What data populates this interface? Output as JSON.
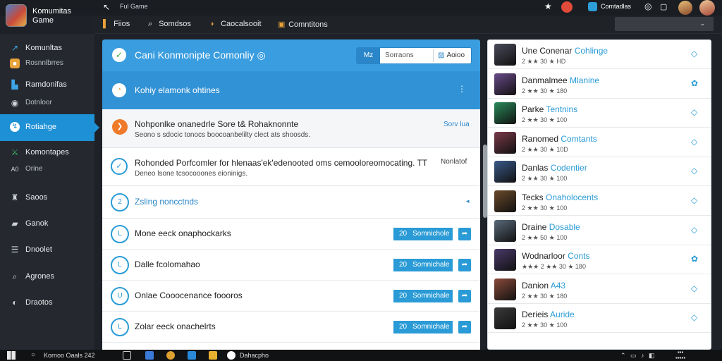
{
  "app": {
    "title": "Komumitas Game"
  },
  "topbar": {
    "title": "Ful Game",
    "contacts": "Comtadlas"
  },
  "tabs": [
    {
      "label": "Fiios"
    },
    {
      "label": "Somdsos"
    },
    {
      "label": "Caocalsooit"
    },
    {
      "label": "Comntitons"
    }
  ],
  "sidebar": {
    "items": [
      {
        "label": "Komunltas"
      },
      {
        "label": "Rosnnlbrres"
      },
      {
        "label": "Ramdonifas"
      },
      {
        "label": "Dotnloor"
      },
      {
        "label": "Rotiahge"
      },
      {
        "label": "Komontapes"
      },
      {
        "label": "Orine"
      },
      {
        "label": "Saoos"
      },
      {
        "label": "Ganok"
      },
      {
        "label": "Dnoolet"
      },
      {
        "label": "Agrones"
      },
      {
        "label": "Draotos"
      }
    ],
    "online_prefix": "A0"
  },
  "main": {
    "header": {
      "title": "Cani Konmonipte Comonliy",
      "seg_left": "Mz",
      "seg_search": "Sorraons",
      "seg_right": "Aoioo"
    },
    "subheader": {
      "title": "Kohiy elamonk ohtines",
      "more": "⋮"
    },
    "notification": {
      "line1": "Nohponlke onanedrle Sore t& Rohaknonnte",
      "line2": "Seono s sdocic tonocs boocoanbelilty clect ats shoosds.",
      "link": "Sorv lua"
    },
    "recommended": {
      "line1": "Rohonded Porfcomler for hlenaas'ek'edenooted oms cemooloreomocating. TT",
      "line2": "Deneo lsone tcsocooones eioninigs.",
      "side": "Nonlatof"
    },
    "collapse": {
      "label": "Zsling noncctnds",
      "icon": "2"
    },
    "rows": [
      {
        "icon": "L",
        "label": "Mone eeck onaphockarks",
        "count": "20",
        "badge": "Somnichole"
      },
      {
        "icon": "L",
        "label": "Dalle fcolomahao",
        "count": "20",
        "badge": "Somnichale"
      },
      {
        "icon": "U",
        "label": "Onlae Cooocenance foooros",
        "count": "20",
        "badge": "Somnichale"
      },
      {
        "icon": "L",
        "label": "Zolar eeck onachelrts",
        "count": "20",
        "badge": "Somnichale"
      }
    ]
  },
  "right": {
    "items": [
      {
        "name": "Une Conenar ",
        "hl": "Cohlinge",
        "meta": "2 ★★ 30 ★ HD",
        "avatar": "#4a4a5a"
      },
      {
        "name": "Danmalmee ",
        "hl": "Mlanine",
        "meta": "2 ★★ 30 ★ 180",
        "avatar": "#6a4a8a"
      },
      {
        "name": "Parke ",
        "hl": "Tentnins",
        "meta": "2 ★★ 30 ★ 100",
        "avatar": "#2a8a5a"
      },
      {
        "name": "Ranomed ",
        "hl": "Comtants",
        "meta": "2 ★★ 30 ★ 10D",
        "avatar": "#7a3a4a"
      },
      {
        "name": "Danlas ",
        "hl": "Codentier",
        "meta": "2 ★★ 30 ★ 100",
        "avatar": "#3a5a8a"
      },
      {
        "name": "Tecks ",
        "hl": "Onaholocents",
        "meta": "2 ★★ 30 ★ 100",
        "avatar": "#6a4a2a"
      },
      {
        "name": "Draine ",
        "hl": "Dosable",
        "meta": "2 ★★ 50 ★ 100",
        "avatar": "#5a6a7a"
      },
      {
        "name": "Wodnarloor ",
        "hl": "Conts",
        "meta": "2 ★★ 30 ★ 180",
        "stars": "★★★ 2 ★★ 30 ★ 180",
        "avatar": "#4a3a6a"
      },
      {
        "name": "Danion ",
        "hl": "A43",
        "meta": "2 ★★ 30 ★ 180",
        "avatar": "#8a4a3a"
      },
      {
        "name": "Derieis ",
        "hl": "Auride",
        "meta": "2 ★★ 30 ★ 100",
        "avatar": "#3a3a3a"
      }
    ]
  },
  "taskbar": {
    "search": "Kornoo Oaals 242",
    "app": "Dahacpho"
  }
}
